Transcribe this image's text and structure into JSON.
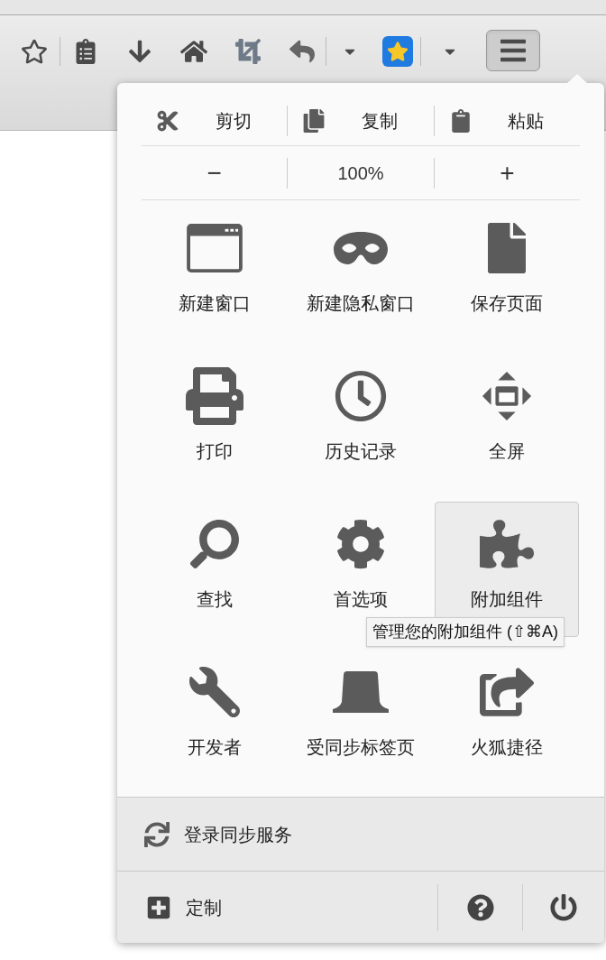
{
  "toolbar": {
    "menu_button": {
      "pressed": true
    }
  },
  "edit_row": [
    {
      "label": "剪切"
    },
    {
      "label": "复制"
    },
    {
      "label": "粘贴"
    }
  ],
  "zoom_row": {
    "decrease": "−",
    "level": "100%",
    "increase": "+"
  },
  "grid": [
    {
      "label": "新建窗口",
      "hovered": false
    },
    {
      "label": "新建隐私窗口",
      "hovered": false
    },
    {
      "label": "保存页面",
      "hovered": false
    },
    {
      "label": "打印",
      "hovered": false
    },
    {
      "label": "历史记录",
      "hovered": false
    },
    {
      "label": "全屏",
      "hovered": false
    },
    {
      "label": "查找",
      "hovered": false
    },
    {
      "label": "首选项",
      "hovered": false
    },
    {
      "label": "附加组件",
      "hovered": true
    },
    {
      "label": "开发者",
      "hovered": false
    },
    {
      "label": "受同步标签页",
      "hovered": false
    },
    {
      "label": "火狐捷径",
      "hovered": false
    }
  ],
  "tooltip": "管理您的附加组件 (⇧⌘A)",
  "sync": {
    "label": "登录同步服务"
  },
  "footer": {
    "customize": "定制"
  }
}
